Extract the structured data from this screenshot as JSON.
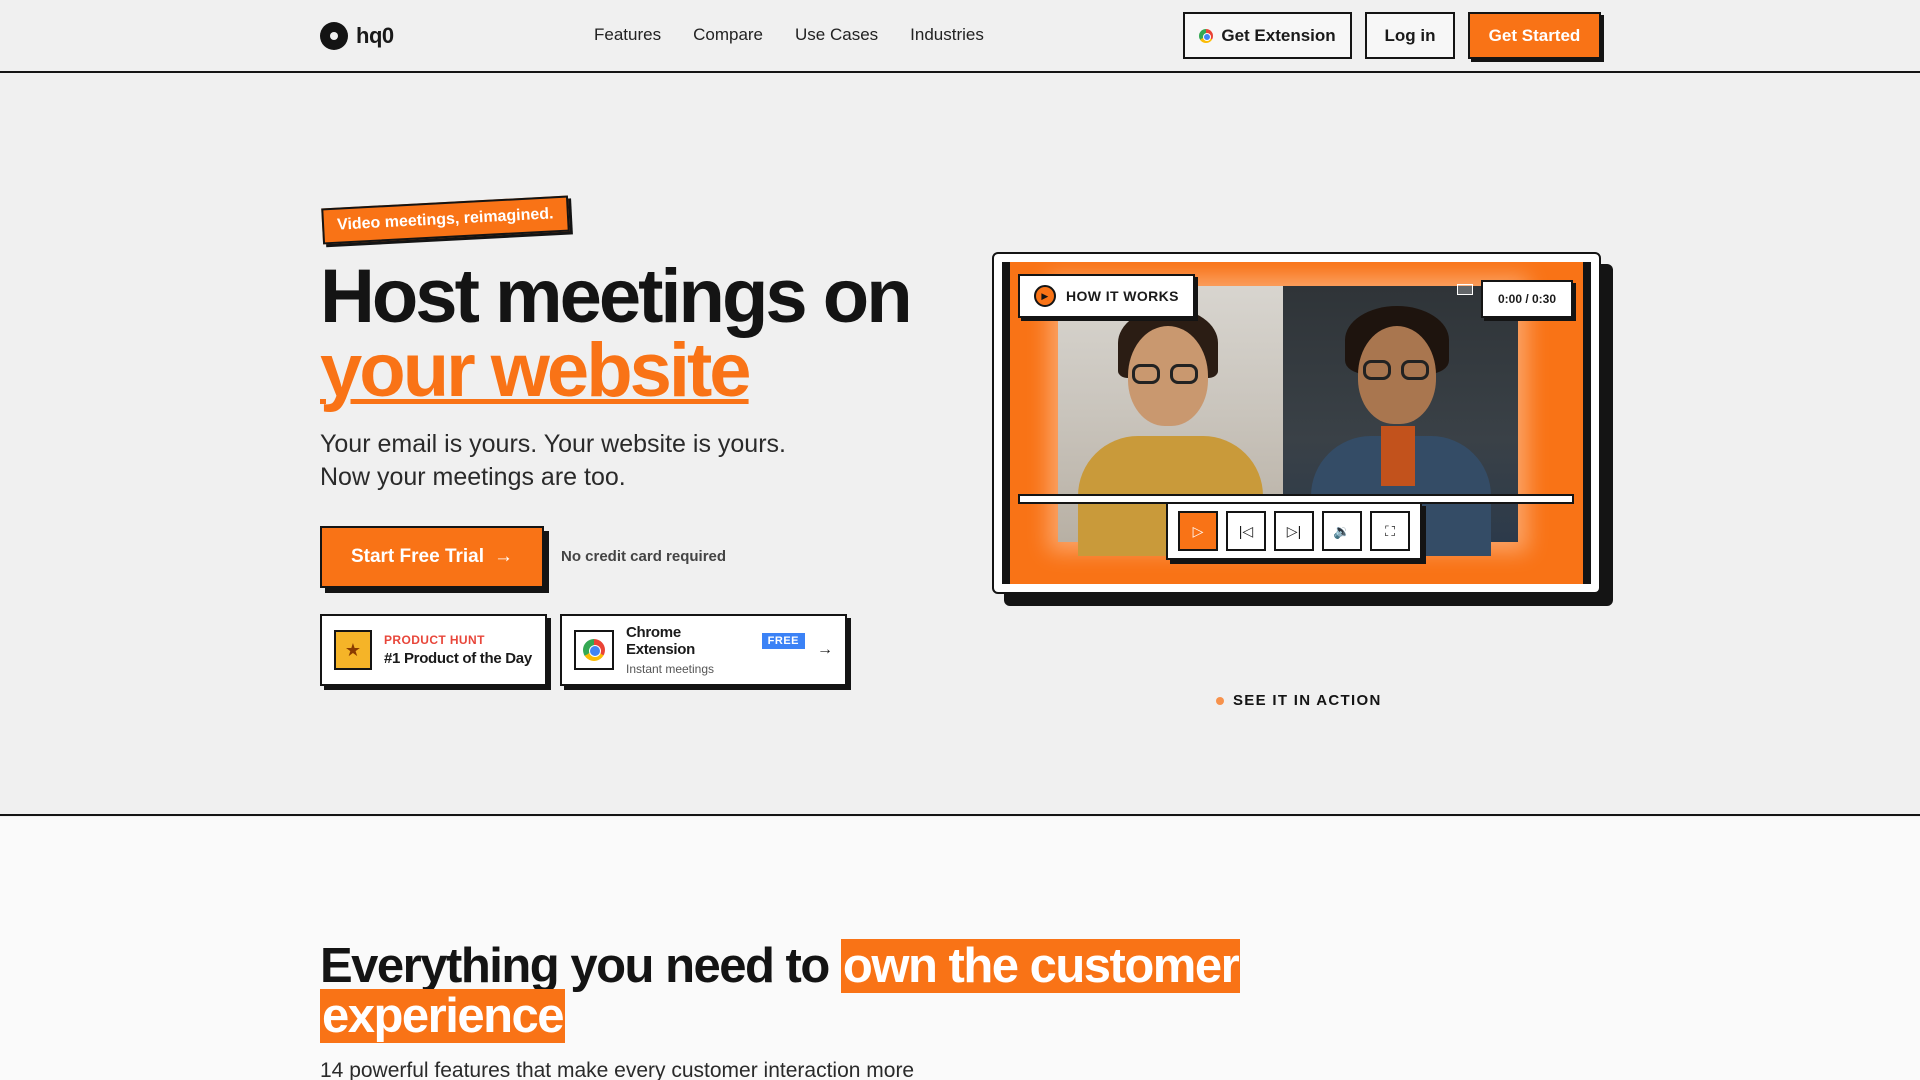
{
  "brand": {
    "name": "hq0"
  },
  "nav": {
    "links": [
      "Features",
      "Compare",
      "Use Cases",
      "Industries"
    ],
    "get_extension": "Get Extension",
    "login": "Log in",
    "get_started": "Get Started"
  },
  "hero": {
    "tagline": "Video meetings, reimagined.",
    "headline_1": "Host meetings on",
    "headline_2": "your website",
    "sub_1": "Your email is yours. Your website is yours.",
    "sub_2": "Now your meetings are too.",
    "cta": "Start Free Trial",
    "cta_icon": "→",
    "no_cc": "No credit card required",
    "badge_ph": {
      "label": "PRODUCT HUNT",
      "title": "#1 Product of the Day",
      "icon": "medal-icon"
    },
    "badge_ce": {
      "title": "Chrome Extension",
      "tag": "FREE",
      "subtitle": "Instant meetings",
      "arrow": "→",
      "icon": "chrome-icon"
    }
  },
  "video": {
    "tab": "HOW IT WORKS",
    "time": "0:00 / 0:30",
    "controls": [
      "play",
      "skip-back",
      "skip-forward",
      "volume",
      "fullscreen"
    ],
    "caption": "SEE IT IN ACTION"
  },
  "features": {
    "title_plain": "Everything you need to ",
    "title_mark_1": "own the customer",
    "title_mark_2": "experience",
    "subtitle": "14 powerful features that make every customer interaction more"
  },
  "colors": {
    "accent": "#f97316",
    "ink": "#141414",
    "background": "#f0f0f0"
  }
}
